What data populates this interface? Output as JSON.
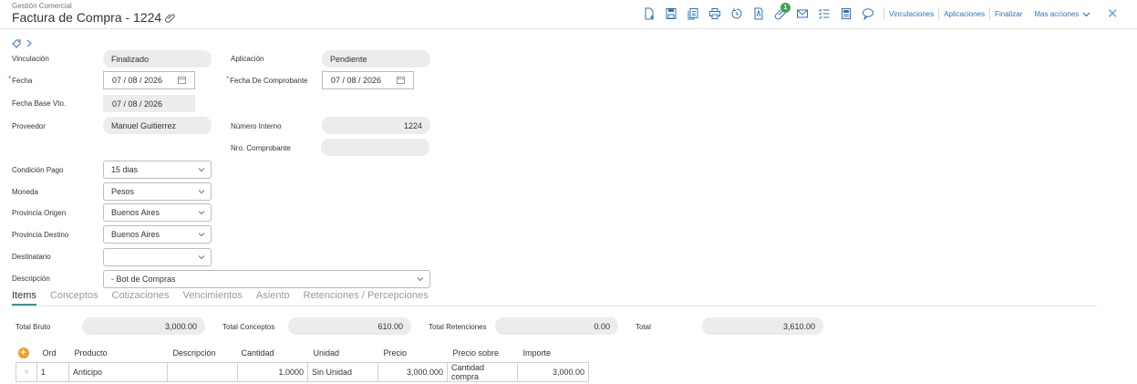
{
  "header": {
    "module": "Gestión Comercial",
    "title": "Factura de Compra - 1224",
    "badge_count": "1",
    "links": {
      "vinculaciones": "Vinculaciones",
      "aplicaciones": "Aplicaciones",
      "finalizar": "Finalizar",
      "mas_acciones": "Mas acciones"
    }
  },
  "form": {
    "vinculacion": {
      "label": "Vinculación",
      "value": "Finalizado"
    },
    "aplicacion": {
      "label": "Aplicación",
      "value": "Pendiente"
    },
    "fecha": {
      "label": "Fecha",
      "value": "07 / 08 / 2026"
    },
    "fecha_comprobante": {
      "label": "Fecha De Comprobante",
      "value": "07 / 08 / 2026"
    },
    "fecha_base_vto": {
      "label": "Fecha Base Vto.",
      "value": "07 / 08 / 2026"
    },
    "proveedor": {
      "label": "Proveedor",
      "value": "Manuel Guitierrez"
    },
    "numero_interno": {
      "label": "Número Interno",
      "value": "1224"
    },
    "nro_comprobante": {
      "label": "Nro. Comprobante",
      "value": ""
    },
    "condicion_pago": {
      "label": "Condición Pago",
      "value": "15 dias"
    },
    "moneda": {
      "label": "Moneda",
      "value": "Pesos"
    },
    "provincia_origen": {
      "label": "Provincia Origen",
      "value": "Buenos Aires"
    },
    "provincia_destino": {
      "label": "Provincia Destino",
      "value": "Buenos Aires"
    },
    "destinatario": {
      "label": "Destinatario",
      "value": ""
    },
    "descripcion": {
      "label": "Descripción",
      "value": "- Bot de Compras"
    }
  },
  "tabs": [
    "Items",
    "Conceptos",
    "Cotizaciones",
    "Vencimientos",
    "Asiento",
    "Retenciones / Percepciones"
  ],
  "totals": {
    "bruto": {
      "label": "Total Bruto",
      "value": "3,000.00"
    },
    "conceptos": {
      "label": "Total Conceptos",
      "value": "610.00"
    },
    "retenciones": {
      "label": "Total Retenciones",
      "value": "0.00"
    },
    "total": {
      "label": "Total",
      "value": "3,610.00"
    }
  },
  "items_table": {
    "columns": [
      "Ord",
      "Producto",
      "Descripción",
      "Cantidad",
      "Unidad",
      "Precio",
      "Precio sobre",
      "Importe"
    ],
    "rows": [
      {
        "ord": "1",
        "producto": "Anticipo",
        "descripcion": "",
        "cantidad": "1.0000",
        "unidad": "Sin Unidad",
        "precio": "3,000.000",
        "precio_sobre": "Cantidad compra",
        "importe": "3,000.00"
      }
    ]
  },
  "colors": {
    "accent": "#2f73b8",
    "tab_underline": "#2f9a9a",
    "badge": "#3fa34d",
    "add_button": "#f0a020"
  }
}
